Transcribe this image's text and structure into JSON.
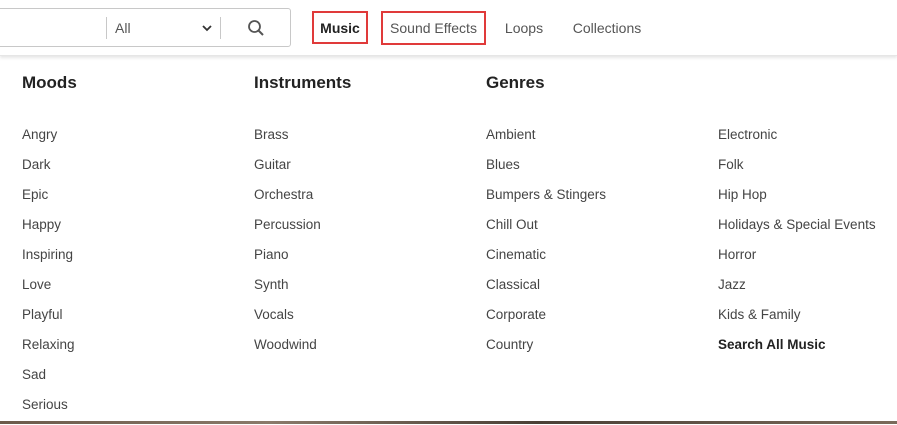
{
  "search": {
    "value": "",
    "placeholder": "",
    "filter_value": "All"
  },
  "nav": {
    "tabs": [
      {
        "label": "Music"
      },
      {
        "label": "Sound Effects"
      },
      {
        "label": "Loops"
      },
      {
        "label": "Collections"
      }
    ]
  },
  "menu": {
    "moods": {
      "title": "Moods",
      "items": [
        "Angry",
        "Dark",
        "Epic",
        "Happy",
        "Inspiring",
        "Love",
        "Playful",
        "Relaxing",
        "Sad",
        "Serious"
      ]
    },
    "instruments": {
      "title": "Instruments",
      "items": [
        "Brass",
        "Guitar",
        "Orchestra",
        "Percussion",
        "Piano",
        "Synth",
        "Vocals",
        "Woodwind"
      ]
    },
    "genres": {
      "title": "Genres",
      "items": [
        "Ambient",
        "Blues",
        "Bumpers & Stingers",
        "Chill Out",
        "Cinematic",
        "Classical",
        "Corporate",
        "Country"
      ]
    },
    "genres_more": {
      "items": [
        "Electronic",
        "Folk",
        "Hip Hop",
        "Holidays & Special Events",
        "Horror",
        "Jazz",
        "Kids & Family"
      ],
      "search_all": "Search All Music"
    }
  },
  "colors": {
    "highlight_outline": "#e03a3a",
    "text": "#444444",
    "heading": "#222222"
  }
}
